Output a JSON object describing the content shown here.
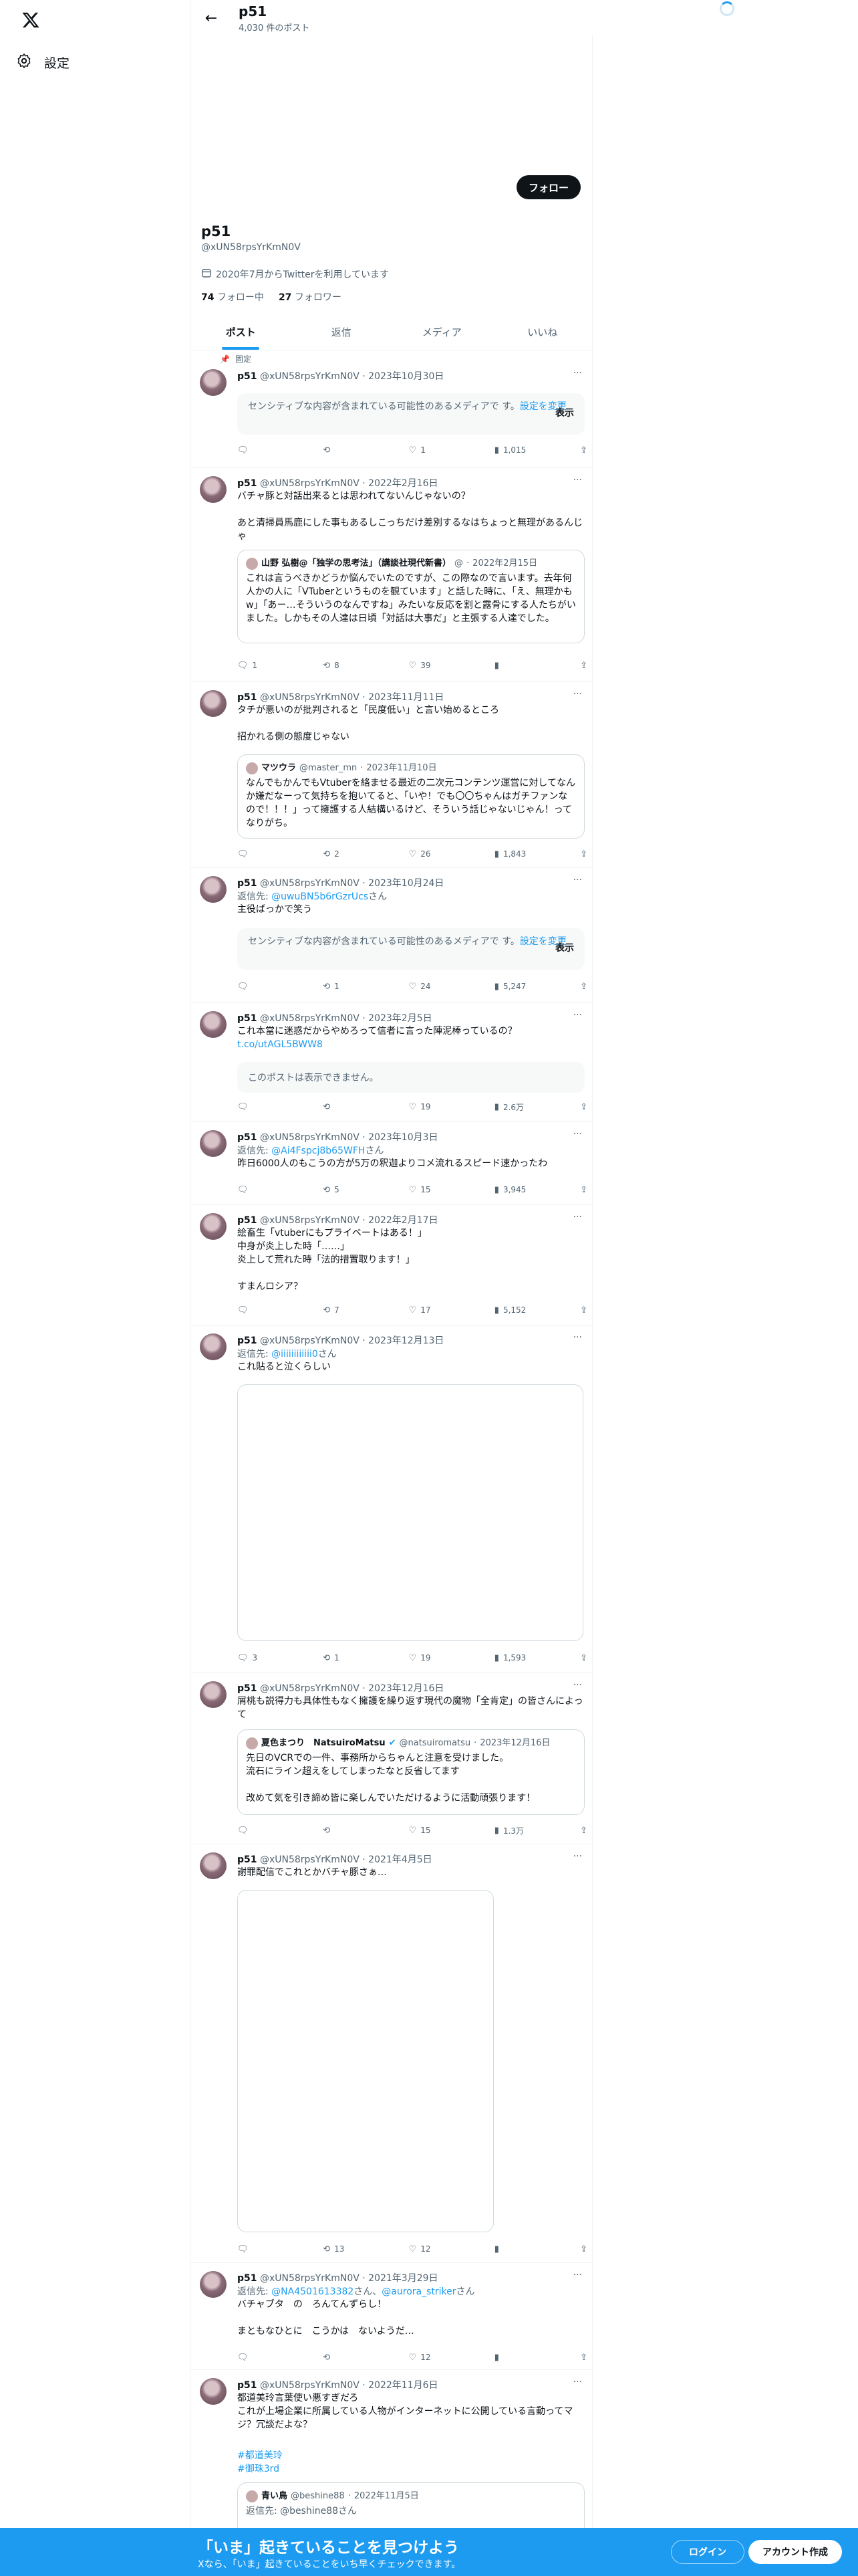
{
  "app": {
    "logo_icon": "x-logo-icon",
    "settings_label": "設定"
  },
  "header": {
    "name": "p51",
    "post_count": "4,030 件のポスト"
  },
  "profile": {
    "follow_label": "フォロー",
    "name": "p51",
    "handle": "@xUN58rpsYrKmN0V",
    "joined": "2020年7月からTwitterを利用しています",
    "following_count": "74",
    "following_label": "フォロー中",
    "followers_count": "27",
    "followers_label": "フォロワー"
  },
  "tabs": [
    "ポスト",
    "返信",
    "メディア",
    "いいね"
  ],
  "pinned_label": "固定",
  "tweets": [
    {
      "name": "p51",
      "handle": "@xUN58rpsYrKmN0V",
      "date": "2023年10月30日",
      "sensitive_text": "センシティブな内容が含まれている可能性のあるメディアで す。",
      "sensitive_link": "設定を変更",
      "sensitive_show": "表示",
      "replies": "",
      "reposts": "",
      "likes": "1",
      "views": "1,015"
    },
    {
      "name": "p51",
      "handle": "@xUN58rpsYrKmN0V",
      "date": "2022年2月16日",
      "text": "バチャ豚と対話出来るとは思われてないんじゃないの？\n\nあと清掃員馬鹿にした事もあるしこっちだけ差別するなはちょっと無理があるんじゃ",
      "quote": {
        "name": "山野 弘樹@「独学の思考法」（講談社現代新書）",
        "handle": "@",
        "date": "2022年2月15日",
        "text": "これは言うべきかどうか悩んでいたのですが、この際なので言います。去年何人かの人に「VTuberというものを観ています」と話した時に、「え、無理かもw」「あー…そういうのなんですね」みたいな反応を割と露骨にする人たちがいました。しかもその人達は日頃「対話は大事だ」と主張する人達でした。"
      },
      "replies": "1",
      "reposts": "8",
      "likes": "39",
      "views": ""
    },
    {
      "name": "p51",
      "handle": "@xUN58rpsYrKmN0V",
      "date": "2023年11月11日",
      "text": "タチが悪いのが批判されると「民度低い」と言い始めるところ\n\n招かれる側の態度じゃない",
      "quote": {
        "name": "マツウラ",
        "handle": "@master_mn",
        "date": "2023年11月10日",
        "text": "なんでもかんでもVtuberを絡ませる最近の二次元コンテンツ運営に対してなんか嫌だなーって気持ちを抱いてると、「いや！でも〇〇ちゃんはガチファンなので！！！」って擁護する人結構いるけど、そういう話じゃないじゃん！ってなりがち。"
      },
      "replies": "",
      "reposts": "2",
      "likes": "26",
      "views": "1,843"
    },
    {
      "name": "p51",
      "handle": "@xUN58rpsYrKmN0V",
      "date": "2023年10月24日",
      "reply_prefix": "返信先: ",
      "reply_to": "@uwuBN5b6rGzrUcs",
      "reply_suffix": "さん",
      "text": "主役ばっかで笑う",
      "sensitive_text": "センシティブな内容が含まれている可能性のあるメディアで す。",
      "sensitive_link": "設定を変更",
      "sensitive_show": "表示",
      "replies": "",
      "reposts": "1",
      "likes": "24",
      "views": "5,247"
    },
    {
      "name": "p51",
      "handle": "@xUN58rpsYrKmN0V",
      "date": "2023年2月5日",
      "text": "これ本當に迷惑だからやめろって信者に言った陣泥棒っているの？",
      "link": "t.co/utAGL5BWW8",
      "unavailable": "このポストは表示できません。",
      "replies": "",
      "reposts": "",
      "likes": "19",
      "views": "2.6万"
    },
    {
      "name": "p51",
      "handle": "@xUN58rpsYrKmN0V",
      "date": "2023年10月3日",
      "reply_prefix": "返信先: ",
      "reply_to": "@Ai4Fspcj8b65WFH",
      "reply_suffix": "さん",
      "text": "昨日6000人のもこうの方が5万の釈迦よりコメ流れるスピード速かったわ",
      "replies": "",
      "reposts": "5",
      "likes": "15",
      "views": "3,945"
    },
    {
      "name": "p51",
      "handle": "@xUN58rpsYrKmN0V",
      "date": "2022年2月17日",
      "text": "絵畜生「vtuberにもプライベートはある！」\n中身が炎上した時「……」\n炎上して荒れた時「法的措置取ります！」\n\nすまんロシア？",
      "replies": "",
      "reposts": "7",
      "likes": "17",
      "views": "5,152"
    },
    {
      "name": "p51",
      "handle": "@xUN58rpsYrKmN0V",
      "date": "2023年12月13日",
      "reply_prefix": "返信先: ",
      "reply_to": "@iiiiiiiiiiii0",
      "reply_suffix": "さん",
      "text": "これ貼ると泣くらしい",
      "replies": "3",
      "reposts": "1",
      "likes": "19",
      "views": "1,593"
    },
    {
      "name": "p51",
      "handle": "@xUN58rpsYrKmN0V",
      "date": "2023年12月16日",
      "text": "屑桃も説得力も具体性もなく擁護を繰り返す現代の魔物「全肯定」の皆さんによって",
      "quote": {
        "name": "夏色まつり　NatsuiroMatsu",
        "handle": "@natsuiromatsu",
        "date": "2023年12月16日",
        "text": "先日のVCRでの一件、事務所からちゃんと注意を受けました。\n流石にライン超えをしてしまったなと反省してます\n\n改めて気を引き締め皆に楽しんでいただけるように活動頑張ります！"
      },
      "replies": "",
      "reposts": "",
      "likes": "15",
      "views": "1.3万"
    },
    {
      "name": "p51",
      "handle": "@xUN58rpsYrKmN0V",
      "date": "2021年4月5日",
      "text": "謝罪配信でこれとかバチャ豚さぁ…",
      "replies": "",
      "reposts": "13",
      "likes": "12",
      "views": ""
    },
    {
      "name": "p51",
      "handle": "@xUN58rpsYrKmN0V",
      "date": "2021年3月29日",
      "reply_prefix": "返信先: ",
      "reply_to": "@NA4501613382",
      "reply_to2": "@aurora_striker",
      "reply_suffix": "さん",
      "text": "バチャブタ　の　ろんてんずらし！\n\nまともなひとに　こうかは　ないようだ…",
      "replies": "",
      "reposts": "",
      "likes": "12",
      "views": ""
    },
    {
      "name": "p51",
      "handle": "@xUN58rpsYrKmN0V",
      "date": "2022年11月6日",
      "text": "都道美玲言葉使い悪すぎだろ\nこれが上場企業に所属している人物がインターネットに公開している言動ってマジ？冗談だよな？",
      "hashtags": [
        "#都道美玲",
        "#御珠3rd"
      ],
      "quote": {
        "name": "青い鳥",
        "handle": "@beshine88",
        "date": "2022年11月5日",
        "text": "返信先: @beshine88さん"
      }
    }
  ],
  "bottom_bar": {
    "title": "「いま」起きていることを見つけよう",
    "subtitle": "Xなら、「いま」起きていることをいち早くチェックできます。",
    "login": "ログイン",
    "signup": "アカウント作成"
  }
}
